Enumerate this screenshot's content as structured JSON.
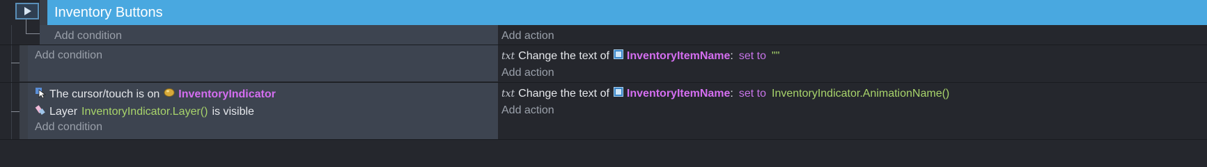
{
  "group": {
    "title": "Inventory Buttons",
    "add_condition": "Add condition",
    "add_action": "Add action"
  },
  "events": [
    {
      "conditions_placeholder": "Add condition",
      "action": {
        "prefix": "Change the text of",
        "object": "InventoryItemName",
        "colon": ":",
        "keyword": "set to",
        "value": "\"\""
      },
      "add_action": "Add action"
    },
    {
      "conditions": [
        {
          "prefix": "The cursor/touch is on",
          "object": "InventoryIndicator"
        },
        {
          "prefix": "Layer",
          "expression": "InventoryIndicator.Layer()",
          "suffix": "is visible"
        }
      ],
      "add_condition": "Add condition",
      "action": {
        "prefix": "Change the text of",
        "object": "InventoryItemName",
        "colon": ":",
        "keyword": "set to",
        "value": "InventoryIndicator.AnimationName()"
      },
      "add_action": "Add action"
    }
  ],
  "icons": {
    "text_action": "txt",
    "text_object": "text-object-icon",
    "cursor_condition": "cursor-icon",
    "sprite_object": "sprite-icon",
    "layer_condition": "layer-icon"
  },
  "colors": {
    "header": "#49a8e0",
    "object_name": "#d46ef0",
    "expression": "#a8d46b",
    "keyword": "#c774e8"
  }
}
